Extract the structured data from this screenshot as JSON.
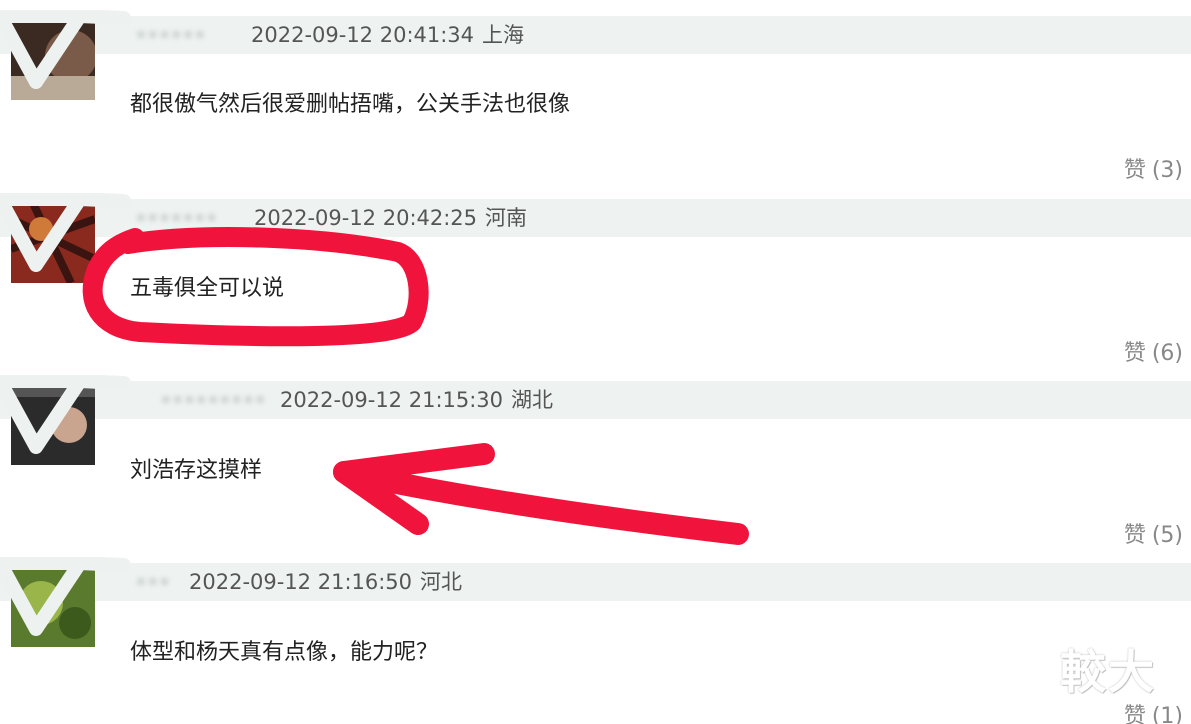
{
  "comments": [
    {
      "username": "••••••",
      "timestamp": "2022-09-12 20:41:34",
      "location": "上海",
      "text": "都很傲气然后很爱删帖捂嘴，公关手法也很像",
      "like_label": "赞",
      "like_count": "(3)"
    },
    {
      "username": "•••••••",
      "timestamp": "2022-09-12 20:42:25",
      "location": "河南",
      "text": "五毒俱全可以说",
      "like_label": "赞",
      "like_count": "(6)"
    },
    {
      "username": "•••••••••",
      "timestamp": "2022-09-12 21:15:30",
      "location": "湖北",
      "text": "刘浩存这摸样",
      "like_label": "赞",
      "like_count": "(5)"
    },
    {
      "username": "•••",
      "timestamp": "2022-09-12 21:16:50",
      "location": "河北",
      "text": "体型和杨天真有点像，能力呢？",
      "like_label": "赞",
      "like_count": "(1)"
    }
  ],
  "watermark": "較大",
  "colors": {
    "header_bar": "#eef3f1",
    "annotation_red": "#f0143c",
    "timestamp_text": "#555555",
    "like_text": "#888888"
  },
  "icons": {
    "avatar_badge": "down-triangle-badge-icon"
  }
}
